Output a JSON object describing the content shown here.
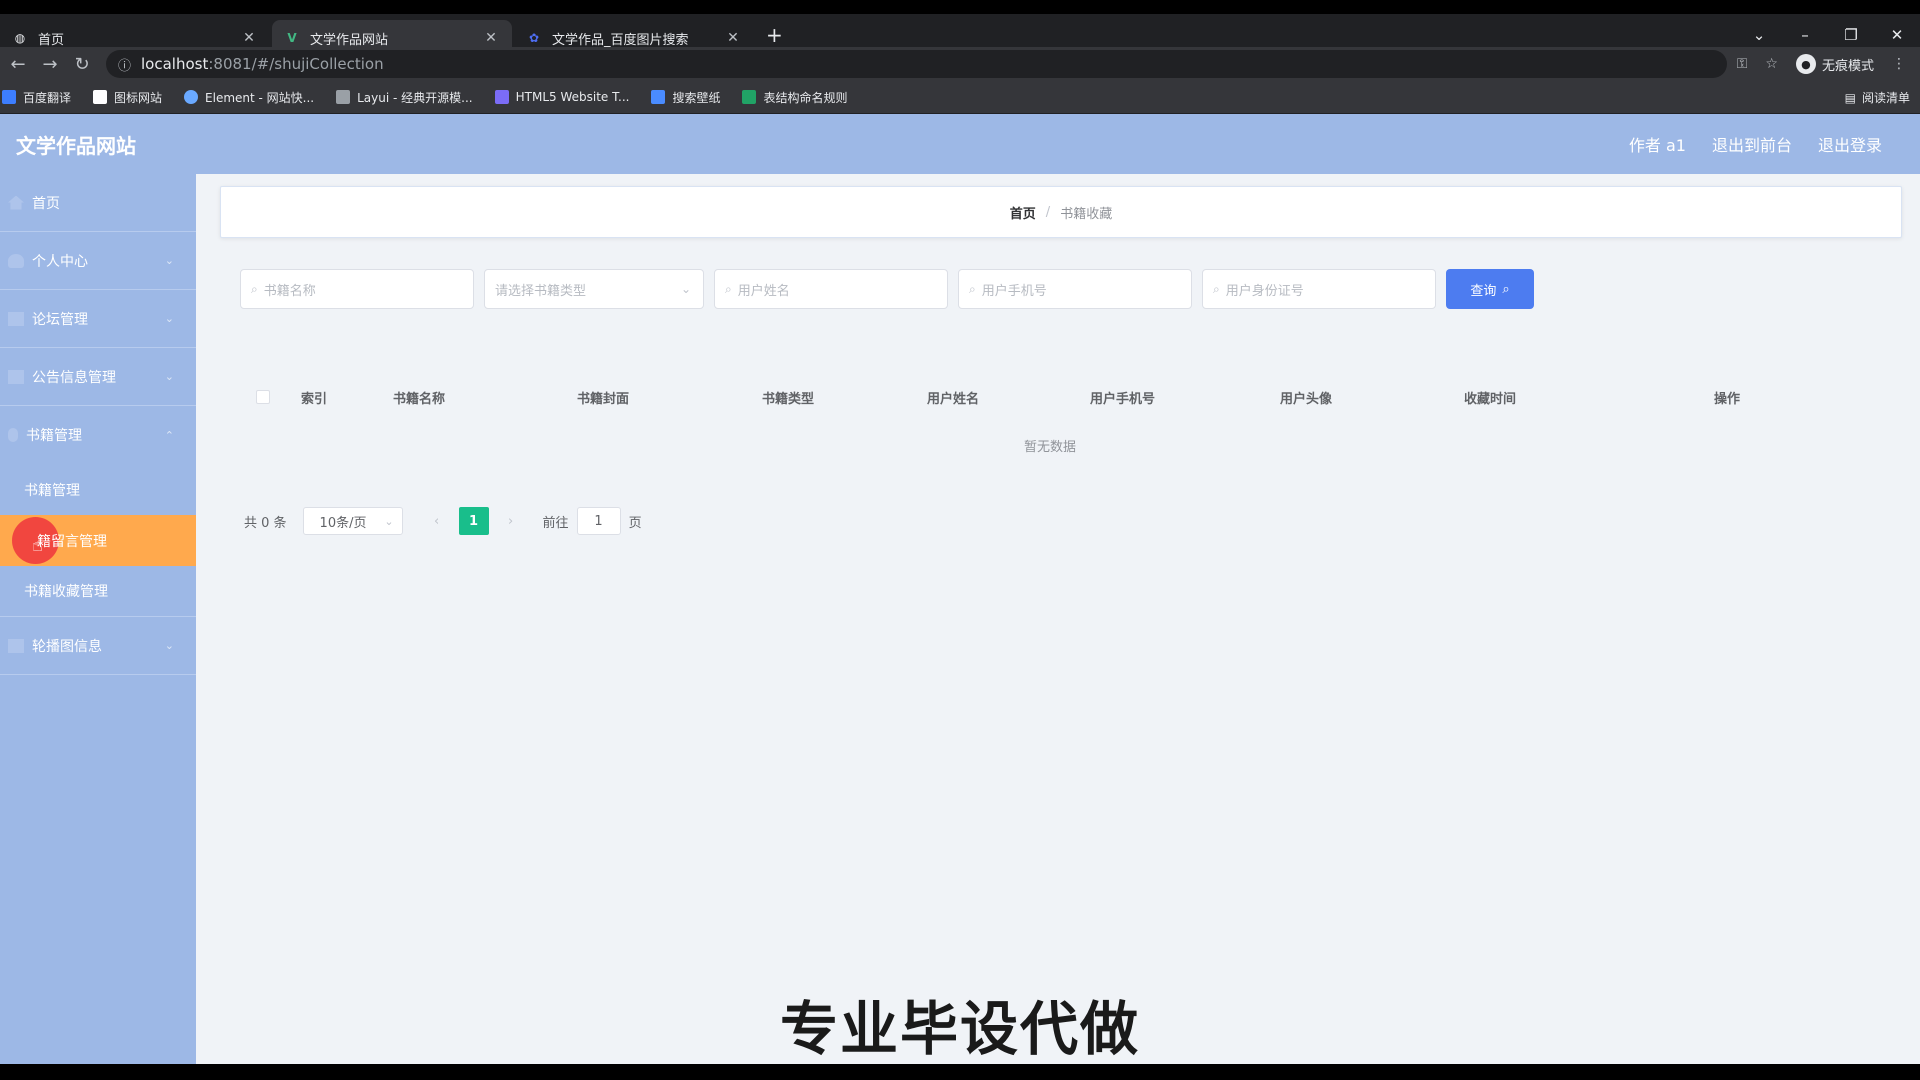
{
  "browser": {
    "tabs": [
      {
        "label": "首页",
        "active": false
      },
      {
        "label": "文学作品网站",
        "active": true
      },
      {
        "label": "文学作品_百度图片搜索",
        "active": false
      }
    ],
    "url_host": "localhost",
    "url_path": ":8081/#/shujiCollection",
    "incognito_label": "无痕模式",
    "bookmarks": [
      "百度翻译",
      "图标网站",
      "Element - 网站快...",
      "Layui - 经典开源模...",
      "HTML5 Website T...",
      "搜索壁纸",
      "表结构命名规则"
    ],
    "reading_list": "阅读清单"
  },
  "header": {
    "logo": "文学作品网站",
    "user": "作者 a1",
    "back_to_front": "退出到前台",
    "logout": "退出登录"
  },
  "sidebar": {
    "items": [
      "首页",
      "个人中心",
      "论坛管理",
      "公告信息管理",
      "书籍管理"
    ],
    "sub_items": [
      "书籍管理",
      "书籍留言管理",
      "书籍收藏管理"
    ],
    "last_item": "轮播图信息",
    "active_sub_visible": "籍留言管理"
  },
  "breadcrumb": {
    "home": "首页",
    "sep": "/",
    "current": "书籍收藏"
  },
  "search": {
    "book_name_placeholder": "书籍名称",
    "book_type_placeholder": "请选择书籍类型",
    "user_name_placeholder": "用户姓名",
    "user_phone_placeholder": "用户手机号",
    "user_id_placeholder": "用户身份证号",
    "query_label": "查询"
  },
  "table": {
    "columns": [
      "索引",
      "书籍名称",
      "书籍封面",
      "书籍类型",
      "用户姓名",
      "用户手机号",
      "用户头像",
      "收藏时间",
      "操作"
    ],
    "empty_text": "暂无数据"
  },
  "pagination": {
    "total": "共 0 条",
    "page_size": "10条/页",
    "current_page": "1",
    "goto_label": "前往",
    "goto_value": "1",
    "page_suffix": "页"
  },
  "watermark": "专业毕设代做"
}
